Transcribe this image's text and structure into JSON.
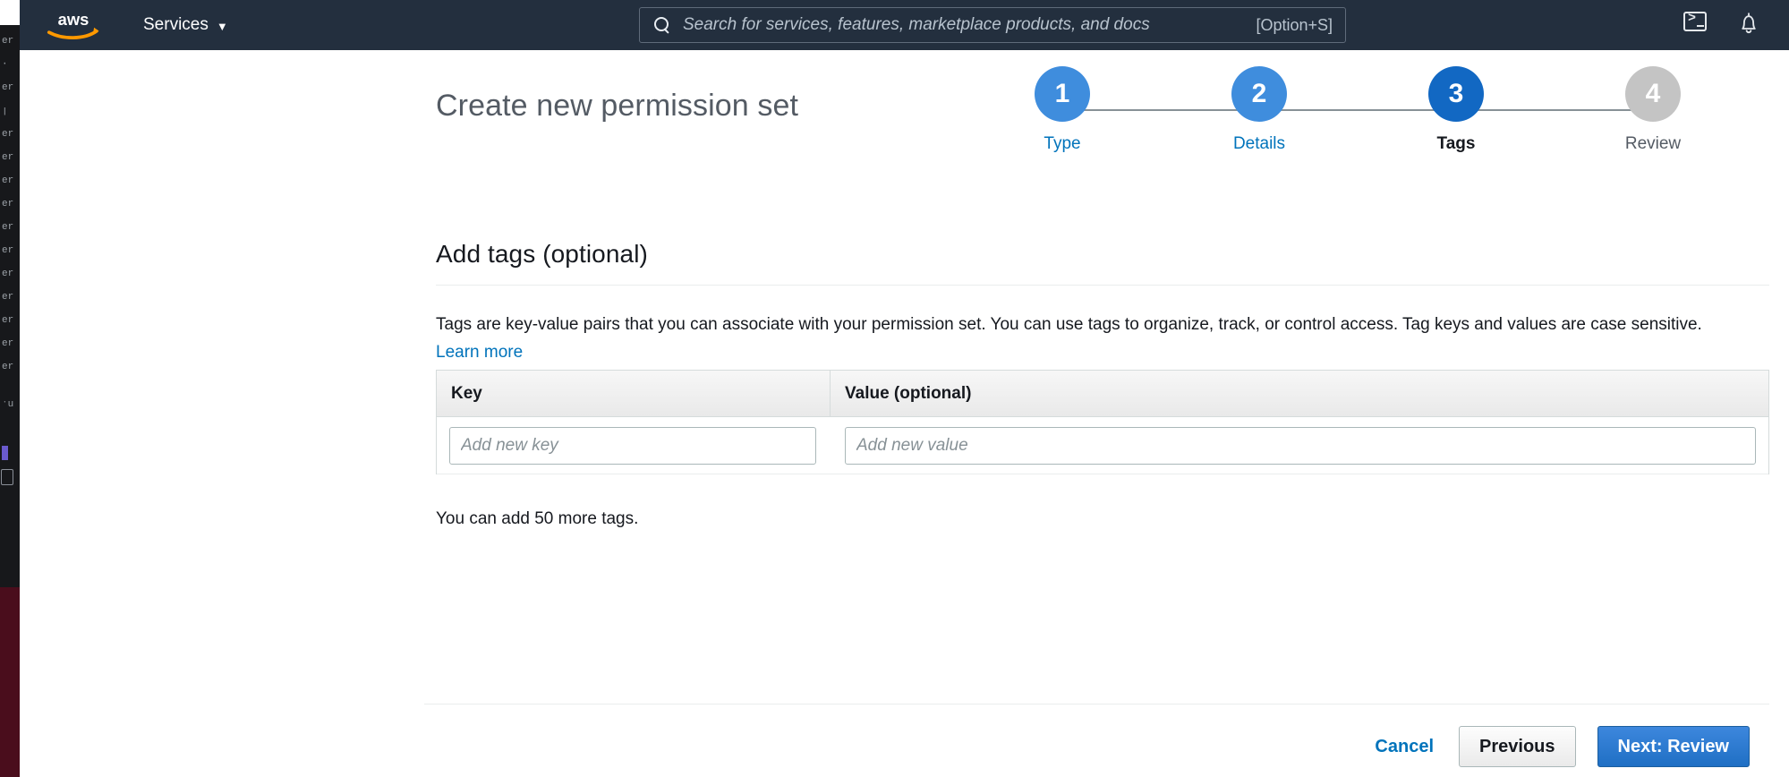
{
  "topnav": {
    "logo_alt": "aws",
    "services_label": "Services",
    "search": {
      "placeholder": "Search for services, features, marketplace products, and docs",
      "shortcut": "[Option+S]",
      "value": ""
    },
    "icons": {
      "cloudshell": "cloudshell-icon",
      "notifications": "bell-icon"
    }
  },
  "page": {
    "title": "Create new permission set"
  },
  "steps": [
    {
      "number": "1",
      "label": "Type",
      "state": "done"
    },
    {
      "number": "2",
      "label": "Details",
      "state": "done"
    },
    {
      "number": "3",
      "label": "Tags",
      "state": "current"
    },
    {
      "number": "4",
      "label": "Review",
      "state": "todo"
    }
  ],
  "section": {
    "heading": "Add tags (optional)",
    "description_part1": "Tags are key-value pairs that you can associate with your permission set. You can use tags to organize, track, or control access. Tag keys and values are case sensitive. ",
    "learn_more_label": "Learn more"
  },
  "tag_table": {
    "columns": [
      "Key",
      "Value (optional)"
    ],
    "rows": [
      {
        "key_value": "",
        "key_placeholder": "Add new key",
        "value_value": "",
        "value_placeholder": "Add new value"
      }
    ],
    "footnote": "You can add 50 more tags."
  },
  "footer": {
    "cancel_label": "Cancel",
    "previous_label": "Previous",
    "next_label": "Next: Review"
  },
  "colors": {
    "nav_background": "#232f3e",
    "link_blue": "#0073bb",
    "step_done": "#3f8ddd",
    "step_current": "#1268c3",
    "step_todo": "#c4c4c4",
    "primary_button": "#1f6fc4"
  }
}
